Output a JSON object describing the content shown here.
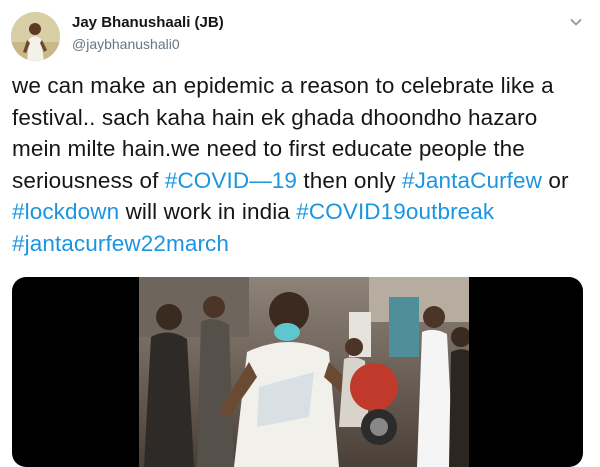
{
  "tweet": {
    "display_name": "Jay Bhanushaali (JB)",
    "handle": "@jaybhanushali0",
    "text_lines": [
      [
        {
          "t": "we can make an epidemic a reason to celebrate like a"
        }
      ],
      [
        {
          "t": "festival.. sach kaha hain ek ghada dhoondho hazaro"
        }
      ],
      [
        {
          "t": "mein milte hain.we need to first educate people the"
        }
      ],
      [
        {
          "t": "seriousness of "
        },
        {
          "t": "#COVID—19",
          "tag": true
        },
        {
          "t": " then only "
        },
        {
          "t": "#JantaCurfew",
          "tag": true
        },
        {
          "t": " or"
        }
      ],
      [
        {
          "t": "#lockdown",
          "tag": true
        },
        {
          "t": " will work in india "
        },
        {
          "t": "#COVID19outbreak",
          "tag": true
        }
      ],
      [
        {
          "t": "#jantacurfew22march",
          "tag": true
        }
      ]
    ]
  },
  "icons": {
    "menu": "chevron-down-icon",
    "avatar": "profile-photo"
  },
  "colors": {
    "hashtag": "#1b95e0",
    "handle": "#657786",
    "text": "#14171a",
    "media_background": "#000000"
  }
}
